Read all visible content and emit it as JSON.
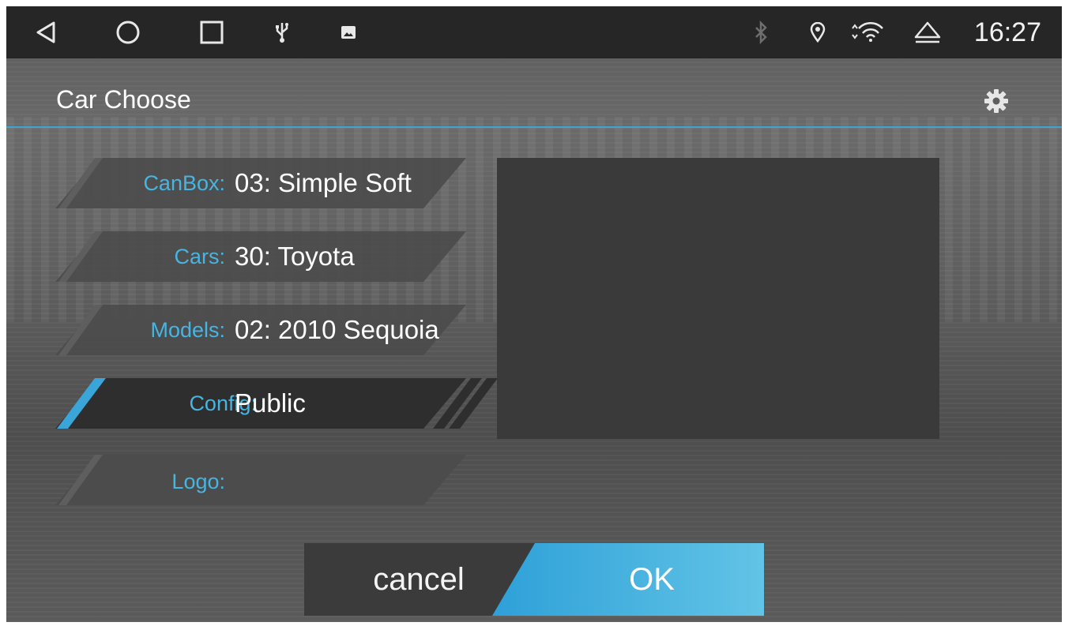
{
  "status_bar": {
    "nav": [
      "back-icon",
      "home-icon",
      "recents-icon"
    ],
    "notifications": [
      "usb-icon",
      "image-icon"
    ],
    "indicators": [
      "bluetooth-icon",
      "location-icon",
      "wifi-icon",
      "eject-icon"
    ],
    "time": "16:27"
  },
  "header": {
    "title": "Car Choose",
    "settings_icon": "gear-icon"
  },
  "rows": [
    {
      "label": "CanBox:",
      "value": "03: Simple Soft",
      "selected": false
    },
    {
      "label": "Cars:",
      "value": "30: Toyota",
      "selected": false
    },
    {
      "label": "Models:",
      "value": "02: 2010 Sequoia",
      "selected": false
    },
    {
      "label": "Config:",
      "value": "Public",
      "selected": true
    },
    {
      "label": "Logo:",
      "value": "",
      "selected": false
    }
  ],
  "buttons": {
    "cancel": "cancel",
    "ok": "OK"
  },
  "colors": {
    "accent": "#3ba6d6",
    "label": "#48b4e0",
    "status_bar": "#262626",
    "row": "#4a4a4a",
    "row_selected": "#2f2f2f",
    "preview": "#3a3a3a"
  }
}
